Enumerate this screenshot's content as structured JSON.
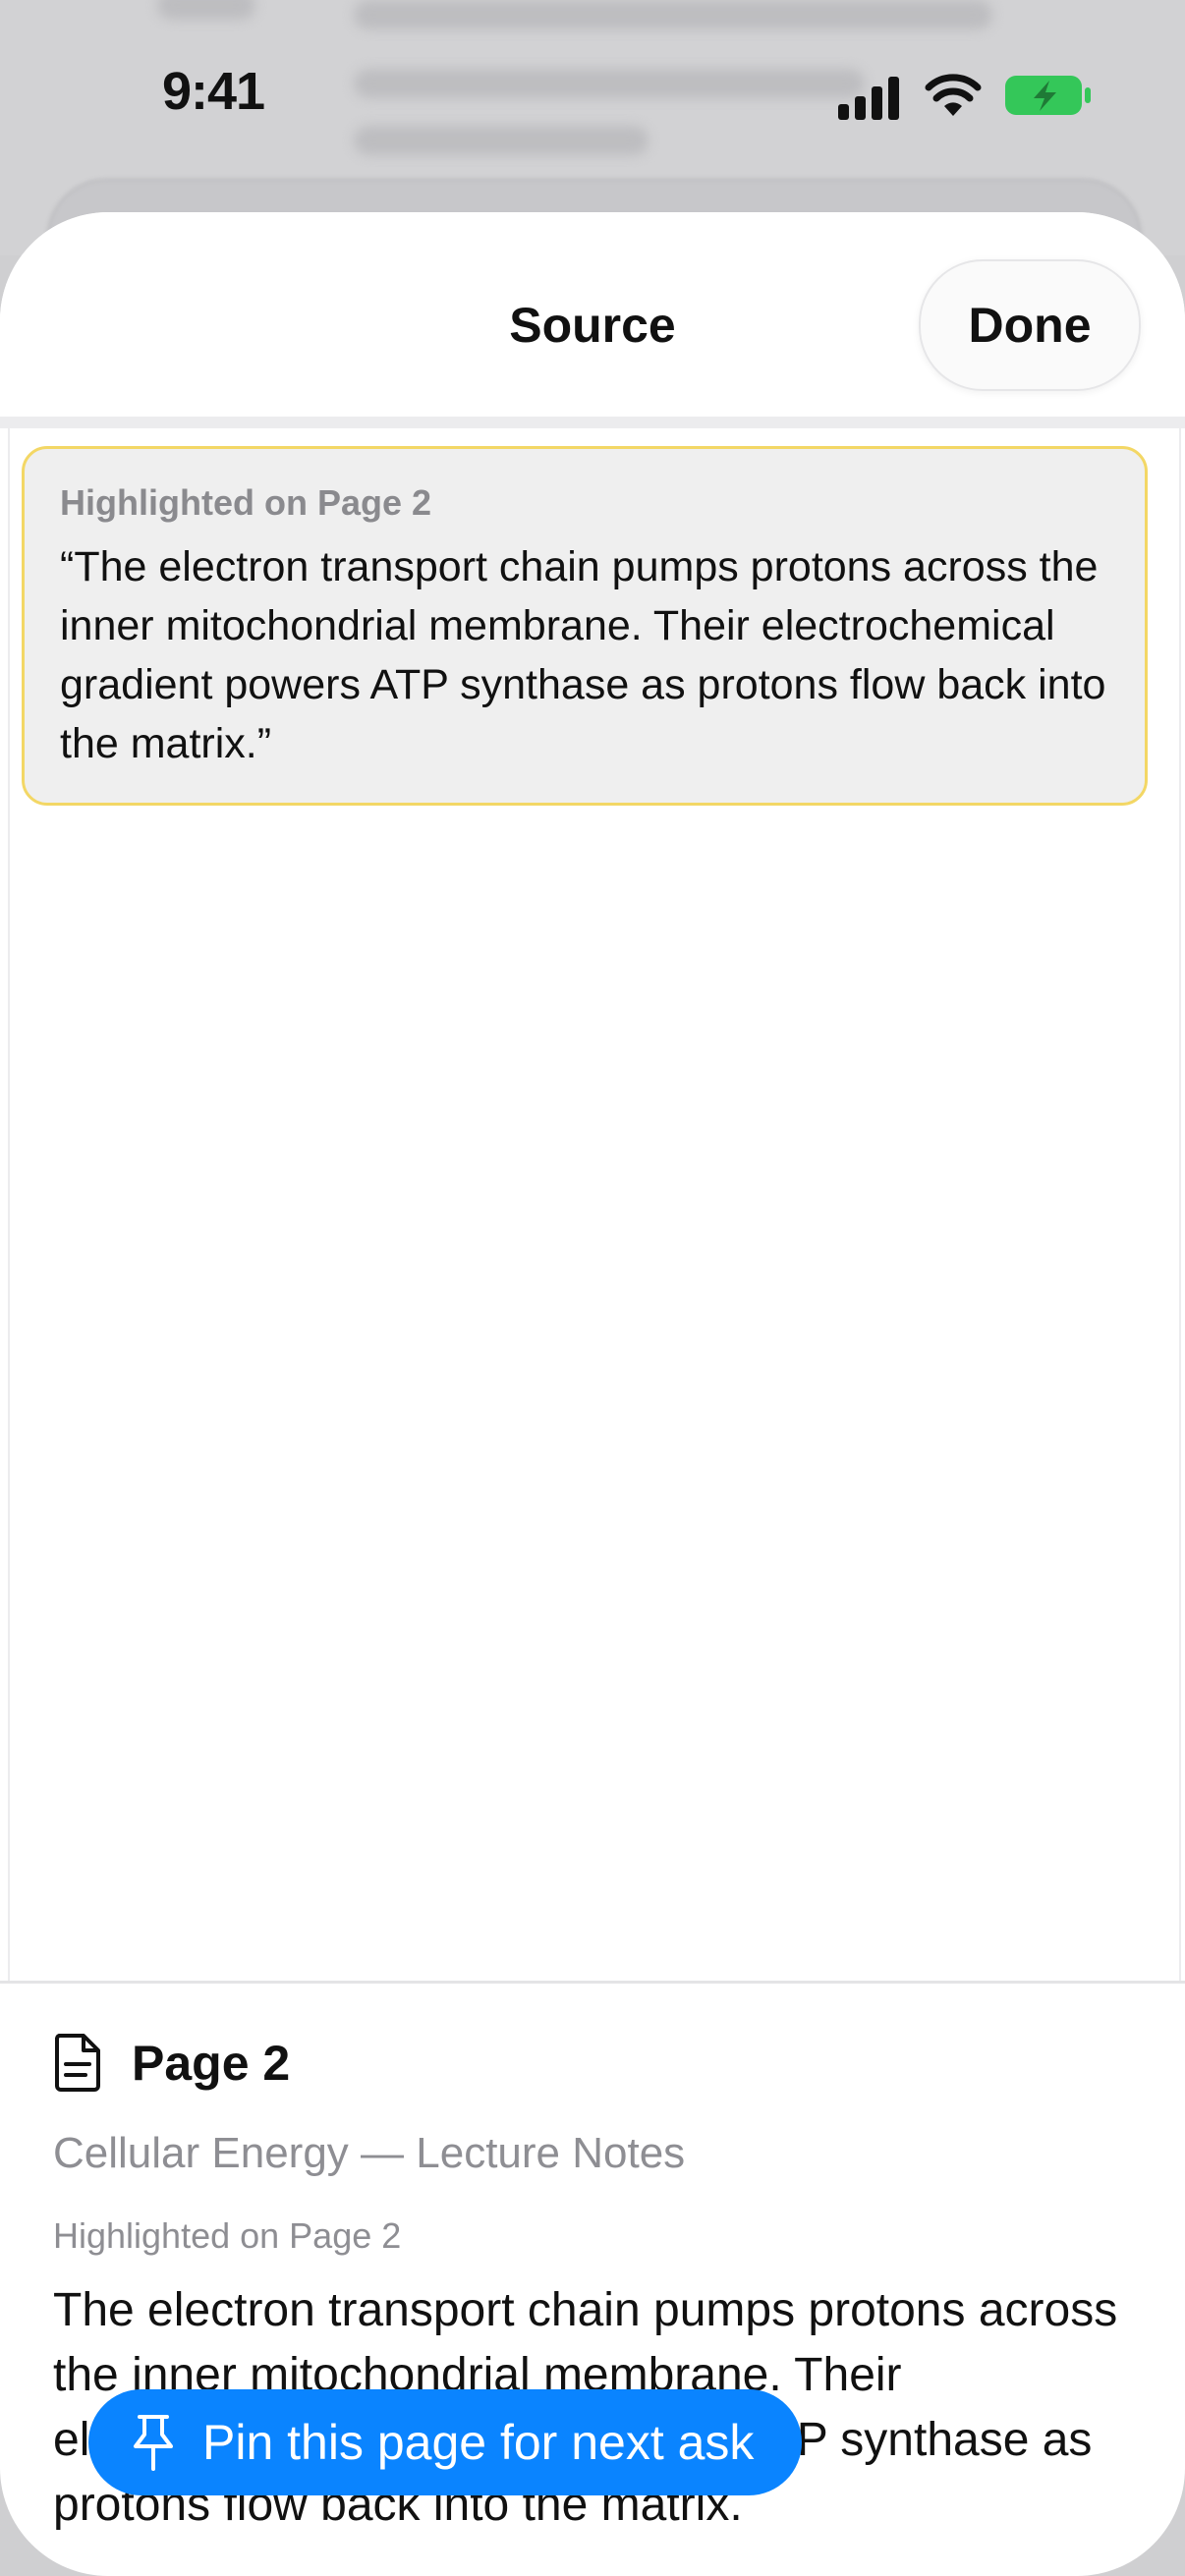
{
  "status_bar": {
    "time": "9:41"
  },
  "sheet": {
    "title": "Source",
    "done_label": "Done"
  },
  "highlight": {
    "label": "Highlighted on Page 2",
    "quote": "“The electron transport chain pumps protons across the inner mitochondrial membrane. Their electrochemical gradient powers ATP synthase as protons flow back into the matrix.”"
  },
  "info": {
    "page_heading": "Page 2",
    "doc_title": "Cellular Energy — Lecture Notes",
    "caption": "Highlighted on Page 2",
    "excerpt": "The electron transport chain pumps protons across the inner mitochondrial membrane. Their electrochemical gradient powers ATP synthase as protons flow back into the matrix.",
    "pin_label": "Pin this page for next ask"
  },
  "colors": {
    "accent": "#0a84ff",
    "highlight_border": "#f3d765",
    "battery": "#34c759"
  },
  "icons": [
    "signal-icon",
    "wifi-icon",
    "battery-icon",
    "document-icon",
    "pin-icon"
  ]
}
